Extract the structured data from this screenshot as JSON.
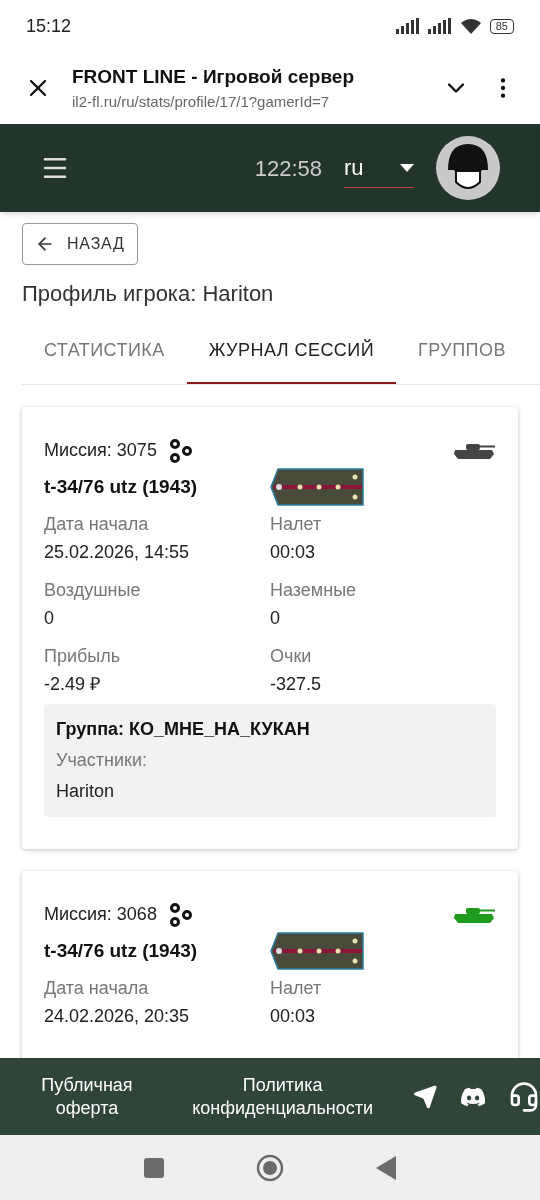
{
  "status_bar": {
    "time": "15:12",
    "battery": "85"
  },
  "browser": {
    "title": "FRONT LINE - Игровой сервер",
    "url": "il2-fl.ru/ru/stats/profile/17/1?gamerId=7"
  },
  "header": {
    "timer": "122:58",
    "language": "ru"
  },
  "back_button": "НАЗАД",
  "page_title": "Профиль игрока: Hariton",
  "tabs": [
    {
      "label": "СТАТИСТИКА",
      "selected": false
    },
    {
      "label": "ЖУРНАЛ СЕССИЙ",
      "selected": true
    },
    {
      "label": "ГРУППОВ",
      "selected": false
    }
  ],
  "sessions": [
    {
      "mission": "Миссия: 3075",
      "vehicle": "t-34/76 utz (1943)",
      "color": "#444444",
      "fields": [
        {
          "label": "Дата начала",
          "value": "25.02.2026, 14:55"
        },
        {
          "label": "Налет",
          "value": "00:03"
        },
        {
          "label": "Воздушные",
          "value": "0"
        },
        {
          "label": "Наземные",
          "value": "0"
        },
        {
          "label": "Прибыль",
          "value": "-2.49 ₽"
        },
        {
          "label": "Очки",
          "value": "-327.5"
        }
      ],
      "group": {
        "title": "Группа: КО_МНЕ_НА_КУКАН",
        "members_label": "Участники:",
        "members": "Hariton"
      }
    },
    {
      "mission": "Миссия: 3068",
      "vehicle": "t-34/76 utz (1943)",
      "color": "#1e9a1e",
      "fields": [
        {
          "label": "Дата начала",
          "value": "24.02.2026, 20:35"
        },
        {
          "label": "Налет",
          "value": "00:03"
        }
      ]
    }
  ],
  "footer": {
    "links": [
      "Публичная оферта",
      "Политика конфиденциальности"
    ]
  }
}
